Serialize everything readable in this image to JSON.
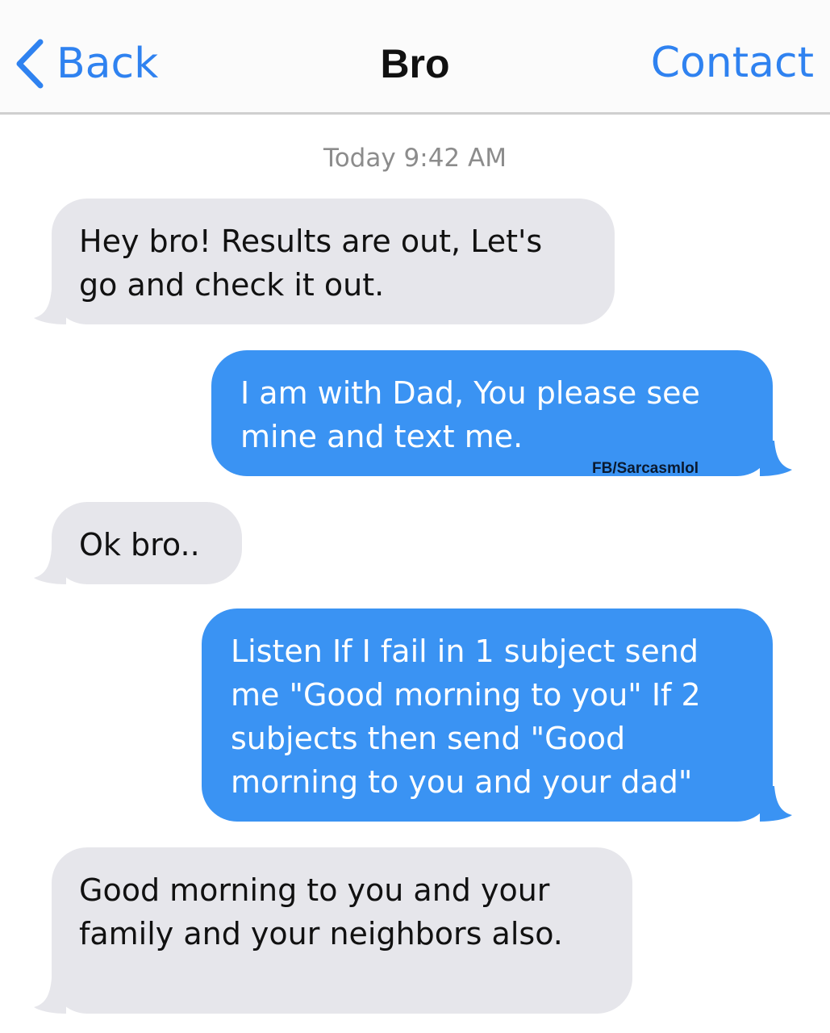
{
  "header": {
    "back_label": "Back",
    "title": "Bro",
    "contact_label": "Contact"
  },
  "timestamp": "Today 9:42 AM",
  "messages": [
    {
      "direction": "incoming",
      "text": "Hey bro! Results are out, Let's\ngo and check it out."
    },
    {
      "direction": "outgoing",
      "text": "I am with Dad, You please see\nmine and text me."
    },
    {
      "direction": "incoming",
      "text": "Ok bro.."
    },
    {
      "direction": "outgoing",
      "text": "Listen If I fail in 1 subject send\nme \"Good morning to you\" If 2\nsubjects then send \"Good\nmorning to you and your dad\""
    },
    {
      "direction": "incoming",
      "text": "Good morning to you and your\nfamily and your neighbors also."
    }
  ],
  "watermark": "FB/Sarcasmlol",
  "colors": {
    "incoming_bubble": "#e6e6eb",
    "outgoing_bubble": "#3a93f3",
    "accent": "#2f82f0"
  },
  "icons": {
    "back": "chevron-left-icon"
  }
}
